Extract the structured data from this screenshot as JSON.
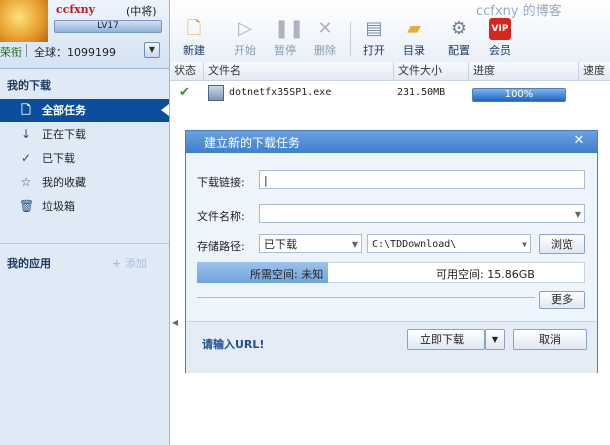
{
  "user": {
    "name": "ccfxny",
    "rank": "(中将)",
    "level": "LV17",
    "badge": "荣衔",
    "global_rank": "全球：1099199"
  },
  "sidebar": {
    "my_downloads": "我的下载",
    "items": [
      {
        "label": "全部任务",
        "icon": "document-icon",
        "selected": true
      },
      {
        "label": "正在下载",
        "icon": "download-arrow-icon"
      },
      {
        "label": "已下载",
        "icon": "check-icon"
      },
      {
        "label": "我的收藏",
        "icon": "star-icon"
      },
      {
        "label": "垃圾箱",
        "icon": "trash-icon"
      }
    ],
    "my_apps": "我的应用",
    "add_label": "添加"
  },
  "toolbar": {
    "buttons": [
      {
        "label": "新建",
        "icon": "new-icon",
        "enabled": true
      },
      {
        "label": "开始",
        "icon": "play-icon",
        "enabled": false
      },
      {
        "label": "暂停",
        "icon": "pause-icon",
        "enabled": false
      },
      {
        "label": "删除",
        "icon": "delete-icon",
        "enabled": false
      },
      {
        "label": "打开",
        "icon": "open-icon",
        "enabled": true
      },
      {
        "label": "目录",
        "icon": "folder-icon",
        "enabled": true
      },
      {
        "label": "配置",
        "icon": "gear-icon",
        "enabled": true
      },
      {
        "label": "会员",
        "icon": "vip-icon",
        "enabled": true
      }
    ],
    "watermark": "ccfxny 的博客"
  },
  "list": {
    "columns": [
      "状态",
      "文件名",
      "文件大小",
      "进度",
      "速度"
    ],
    "rows": [
      {
        "status": "done",
        "filename": "dotnetfx35SP1.exe",
        "size": "231.50MB",
        "progress_text": "100%",
        "progress": 1.0
      }
    ]
  },
  "dialog": {
    "title": "建立新的下载任务",
    "link_label": "下载链接:",
    "link_value": "",
    "name_label": "文件名称:",
    "name_value": "",
    "path_label": "存储路径:",
    "path_category": "已下载",
    "path_value": "C:\\TDDownload\\",
    "browse": "浏览",
    "needed_space": "所需空间: 未知",
    "free_space": "可用空间: 15.86GB",
    "more": "更多",
    "hint": "请输入URL!",
    "download_now": "立即下载",
    "cancel": "取消"
  },
  "colors": {
    "accent": "#0b4f9c",
    "title_bar": "#4f8ed8",
    "progress": "#1f62c3"
  }
}
